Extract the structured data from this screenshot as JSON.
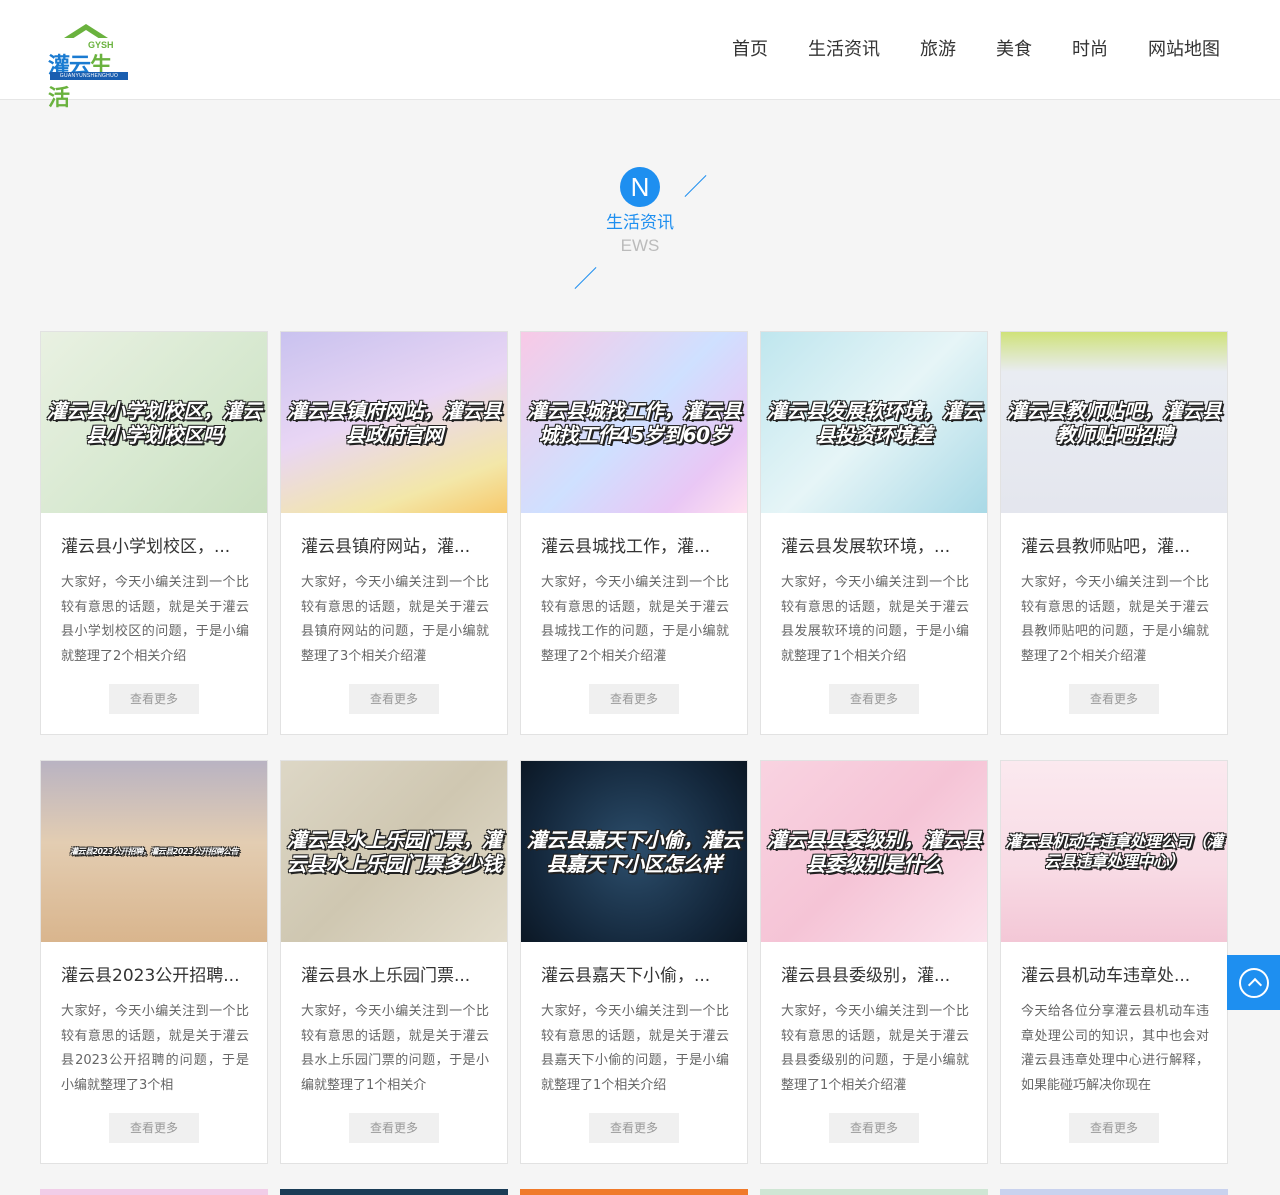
{
  "header": {
    "logo": {
      "small": "GYSH",
      "brand_a": "灌云",
      "brand_b": "生活",
      "sub": "GUANYUNSHENGHUO"
    },
    "nav": [
      "首页",
      "生活资讯",
      "旅游",
      "美食",
      "时尚",
      "网站地图"
    ]
  },
  "section": {
    "badge": "N",
    "title_cn": "生活资讯",
    "title_en": "EWS"
  },
  "more_label": "查看更多",
  "cards": [
    {
      "caption": "灌云县小学划校区，灌云县小学划校区吗",
      "title": "灌云县小学划校区，...",
      "desc": "大家好，今天小编关注到一个比较有意思的话题，就是关于灌云县小学划校区的问题，于是小编就整理了2个相关介绍",
      "bg": "linear-gradient(135deg,#e9f1e2,#d6e8cf 60%,#c9dfc0)"
    },
    {
      "caption": "灌云县镇府网站，灌云县县政府官网",
      "title": "灌云县镇府网站，灌...",
      "desc": "大家好，今天小编关注到一个比较有意思的话题，就是关于灌云县镇府网站的问题，于是小编就整理了3个相关介绍灌",
      "bg": "linear-gradient(160deg,#c9c2ef,#e9d6f4 45%,#f3e7a8 80%,#f7c96c)"
    },
    {
      "caption": "灌云县城找工作，灌云县城找工作45岁到60岁",
      "title": "灌云县城找工作，灌...",
      "desc": "大家好，今天小编关注到一个比较有意思的话题，就是关于灌云县城找工作的问题，于是小编就整理了2个相关介绍灌",
      "bg": "linear-gradient(135deg,#f8c9e6,#cfe0ff 50%,#e9c7f5 80%,#ffe1f0)"
    },
    {
      "caption": "灌云县发展软环境，灌云县投资环境差",
      "title": "灌云县发展软环境，...",
      "desc": "大家好，今天小编关注到一个比较有意思的话题，就是关于灌云县发展软环境的问题，于是小编就整理了1个相关介绍",
      "bg": "linear-gradient(135deg,#bfe6ee,#e6f5f7 50%,#a9d9e6)"
    },
    {
      "caption": "灌云县教师贴吧，灌云县教师贴吧招聘",
      "title": "灌云县教师贴吧，灌...",
      "desc": "大家好，今天小编关注到一个比较有意思的话题，就是关于灌云县教师贴吧的问题，于是小编就整理了2个相关介绍灌",
      "bg": "linear-gradient(180deg,#cfe27a 0%,#e9ecf2 22%,#e4e6ee 100%)"
    },
    {
      "caption": "灌云县2023公开招聘，灌云县2023公开招聘公告",
      "title": "灌云县2023公开招聘...",
      "desc": "大家好，今天小编关注到一个比较有意思的话题，就是关于灌云县2023公开招聘的问题，于是小编就整理了3个相",
      "bg": "linear-gradient(180deg,#b9b3c2 0%,#e3cdb2 45%,#d9b58d 100%)",
      "tiny": true
    },
    {
      "caption": "灌云县水上乐园门票，灌云县水上乐园门票多少钱",
      "title": "灌云县水上乐园门票...",
      "desc": "大家好，今天小编关注到一个比较有意思的话题，就是关于灌云县水上乐园门票的问题，于是小编就整理了1个相关介",
      "bg": "linear-gradient(135deg,#ddd7c6,#cfc7b1 50%,#e2dccb)"
    },
    {
      "caption": "灌云县嘉天下小偷，灌云县嘉天下小区怎么样",
      "title": "灌云县嘉天下小偷，...",
      "desc": "大家好，今天小编关注到一个比较有意思的话题，就是关于灌云县嘉天下小偷的问题，于是小编就整理了1个相关介绍",
      "bg": "radial-gradient(circle at 50% 50%,#2c4e6c,#13263a 70%,#0b1724)"
    },
    {
      "caption": "灌云县县委级别，灌云县县委级别是什么",
      "title": "灌云县县委级别，灌...",
      "desc": "大家好，今天小编关注到一个比较有意思的话题，就是关于灌云县县委级别的问题，于是小编就整理了1个相关介绍灌",
      "bg": "linear-gradient(135deg,#f9d3e1,#f5c4d6 50%,#fbe2ec)"
    },
    {
      "caption": "灌云县机动车违章处理公司（灌云县违章处理中心）",
      "title": "灌云县机动车违章处...",
      "desc": "今天给各位分享灌云县机动车违章处理公司的知识，其中也会对灌云县违章处理中心进行解释，如果能碰巧解决你现在",
      "bg": "linear-gradient(180deg,#fbe9ef 0%,#f8dbe5 60%,#f3c7d6 100%)",
      "small": true
    }
  ],
  "row3_colors": [
    "#f1cde8",
    "#1a3c56",
    "#f07a2a",
    "#cfe6d4",
    "#c9d2ee"
  ]
}
